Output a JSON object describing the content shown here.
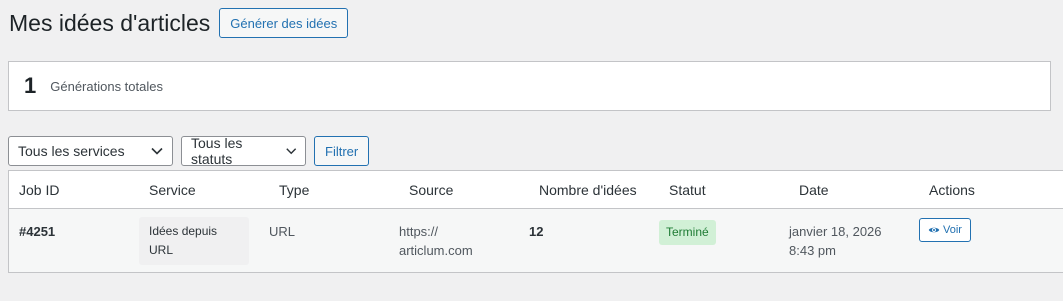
{
  "page": {
    "title": "Mes idées d'articles",
    "generate_button": "Générer des idées"
  },
  "stats": {
    "count": "1",
    "label": "Générations totales"
  },
  "filters": {
    "service_select": "Tous les services",
    "status_select": "Tous les statuts",
    "filter_button": "Filtrer"
  },
  "table": {
    "headers": [
      "Job ID",
      "Service",
      "Type",
      "Source",
      "Nombre d'idées",
      "Statut",
      "Date",
      "Actions"
    ],
    "rows": [
      {
        "job_id": "#4251",
        "service": "Idées depuis URL",
        "type": "URL",
        "source": "https:// articlum.com",
        "ideas_count": "12",
        "status": "Terminé",
        "date": "janvier 18, 2026 8:43 pm",
        "action": "Voir"
      }
    ]
  },
  "colors": {
    "accent": "#2271b1",
    "status_success_bg": "#d1f0d6",
    "status_success_text": "#1e7b34"
  }
}
